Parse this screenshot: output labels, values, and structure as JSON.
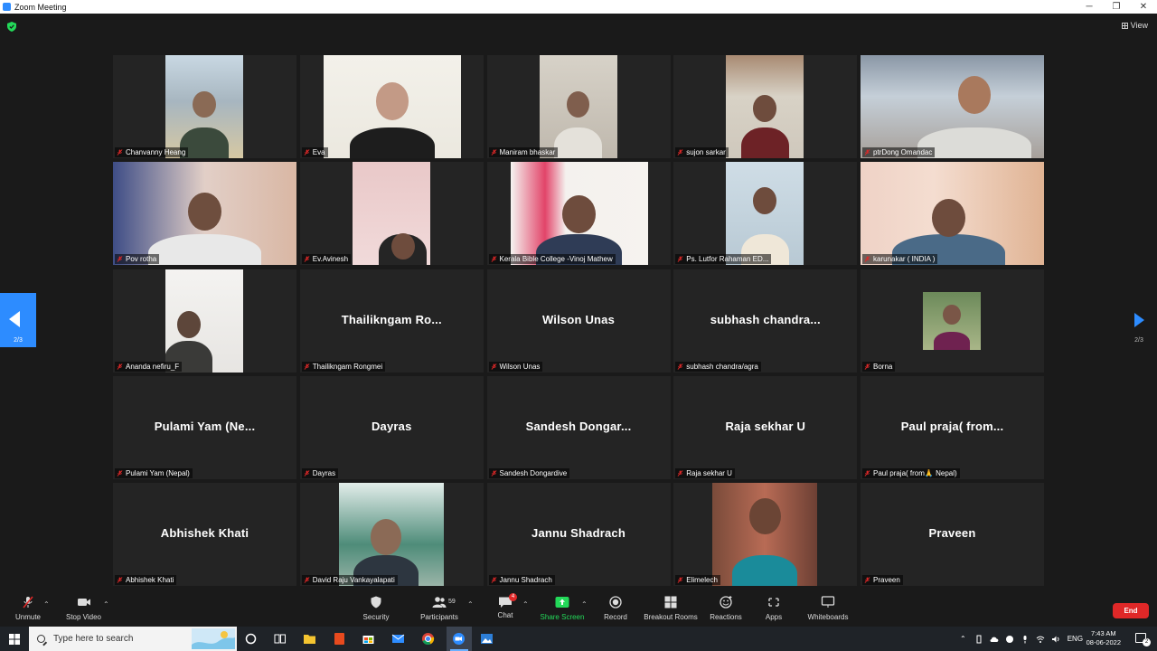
{
  "window": {
    "title": "Zoom Meeting",
    "minimize": "─",
    "maximize": "❐",
    "close": "✕"
  },
  "topbar": {
    "view_label": "View"
  },
  "navigation": {
    "prev_page": "2/3",
    "next_page": "2/3"
  },
  "participants": [
    {
      "name": "Chanvanny Heang",
      "big": "",
      "video": true,
      "v": "a"
    },
    {
      "name": "Eva",
      "big": "",
      "video": true,
      "v": "b"
    },
    {
      "name": "Maniram bhaskar",
      "big": "",
      "video": true,
      "v": "c"
    },
    {
      "name": "sujon sarkar",
      "big": "",
      "video": true,
      "v": "d"
    },
    {
      "name": "ptrDong Omandac",
      "big": "",
      "video": true,
      "v": "e"
    },
    {
      "name": "Pov rotha",
      "big": "",
      "video": true,
      "v": "f"
    },
    {
      "name": "Ev.Avinesh",
      "big": "",
      "video": true,
      "v": "g"
    },
    {
      "name": "Kerala Bible College -Vinoj Mathew",
      "big": "",
      "video": true,
      "v": "h"
    },
    {
      "name": "Ps. Lutfor Rahaman ED...",
      "big": "",
      "video": true,
      "v": "i"
    },
    {
      "name": "karunakar ( INDIA )",
      "big": "",
      "video": true,
      "v": "j"
    },
    {
      "name": "Ananda nefiru_F",
      "big": "",
      "video": true,
      "v": "k"
    },
    {
      "name": "Thailikngam Rongmei",
      "big": "Thailikngam Ro...",
      "video": false,
      "v": ""
    },
    {
      "name": "Wilson Unas",
      "big": "Wilson Unas",
      "video": false,
      "v": ""
    },
    {
      "name": "subhash chandra/agra",
      "big": "subhash chandra...",
      "video": false,
      "v": ""
    },
    {
      "name": "Borna",
      "big": "",
      "video": true,
      "v": "l"
    },
    {
      "name": "Pulami Yam (Nepal)",
      "big": "Pulami Yam (Ne...",
      "video": false,
      "v": ""
    },
    {
      "name": "Dayras",
      "big": "Dayras",
      "video": false,
      "v": ""
    },
    {
      "name": "Sandesh Dongardive",
      "big": "Sandesh Dongar...",
      "video": false,
      "v": ""
    },
    {
      "name": "Raja sekhar U",
      "big": "Raja sekhar U",
      "video": false,
      "v": ""
    },
    {
      "name": "Paul praja( from🙏 Nepal)",
      "big": "Paul praja( from...",
      "video": false,
      "v": ""
    },
    {
      "name": "Abhishek Khati",
      "big": "Abhishek Khati",
      "video": false,
      "v": ""
    },
    {
      "name": "David Raju Vankayalapati",
      "big": "",
      "video": true,
      "v": "m"
    },
    {
      "name": "Jannu Shadrach",
      "big": "Jannu Shadrach",
      "video": false,
      "v": ""
    },
    {
      "name": "Elimelech",
      "big": "",
      "video": true,
      "v": "n"
    },
    {
      "name": "Praveen",
      "big": "Praveen",
      "video": false,
      "v": ""
    }
  ],
  "toolbar": {
    "unmute": "Unmute",
    "stop_video": "Stop Video",
    "security": "Security",
    "participants": "Participants",
    "participants_count": "59",
    "chat": "Chat",
    "chat_badge": "4",
    "share_screen": "Share Screen",
    "record": "Record",
    "breakout_rooms": "Breakout Rooms",
    "reactions": "Reactions",
    "apps": "Apps",
    "whiteboards": "Whiteboards",
    "end": "End"
  },
  "taskbar": {
    "search_placeholder": "Type here to search",
    "language": "ENG",
    "time": "7:43 AM",
    "date": "08-06-2022",
    "notifications": "2"
  },
  "colors": {
    "accent": "#2d8cff",
    "end": "#e02828",
    "share": "#23d959",
    "bg": "#1a1a1a",
    "tile": "#242424"
  }
}
